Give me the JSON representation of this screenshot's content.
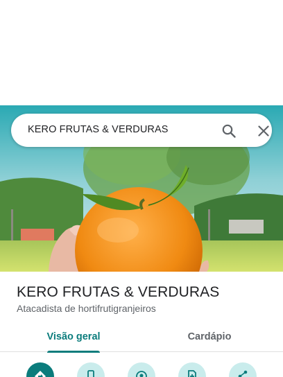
{
  "search": {
    "query": "KERO FRUTAS & VERDURAS"
  },
  "place": {
    "name": "KERO FRUTAS & VERDURAS",
    "category": "Atacadista de hortifrutigranjeiros"
  },
  "tabs": [
    {
      "label": "Visão geral",
      "selected": true
    },
    {
      "label": "Cardápio",
      "selected": false
    }
  ],
  "actions": [
    {
      "icon": "directions-icon"
    },
    {
      "icon": "phone-icon"
    },
    {
      "icon": "nearby-icon"
    },
    {
      "icon": "save-icon"
    },
    {
      "icon": "share-icon"
    }
  ],
  "colors": {
    "accent": "#0b7c7c",
    "action_bg": "#c9ecec"
  }
}
